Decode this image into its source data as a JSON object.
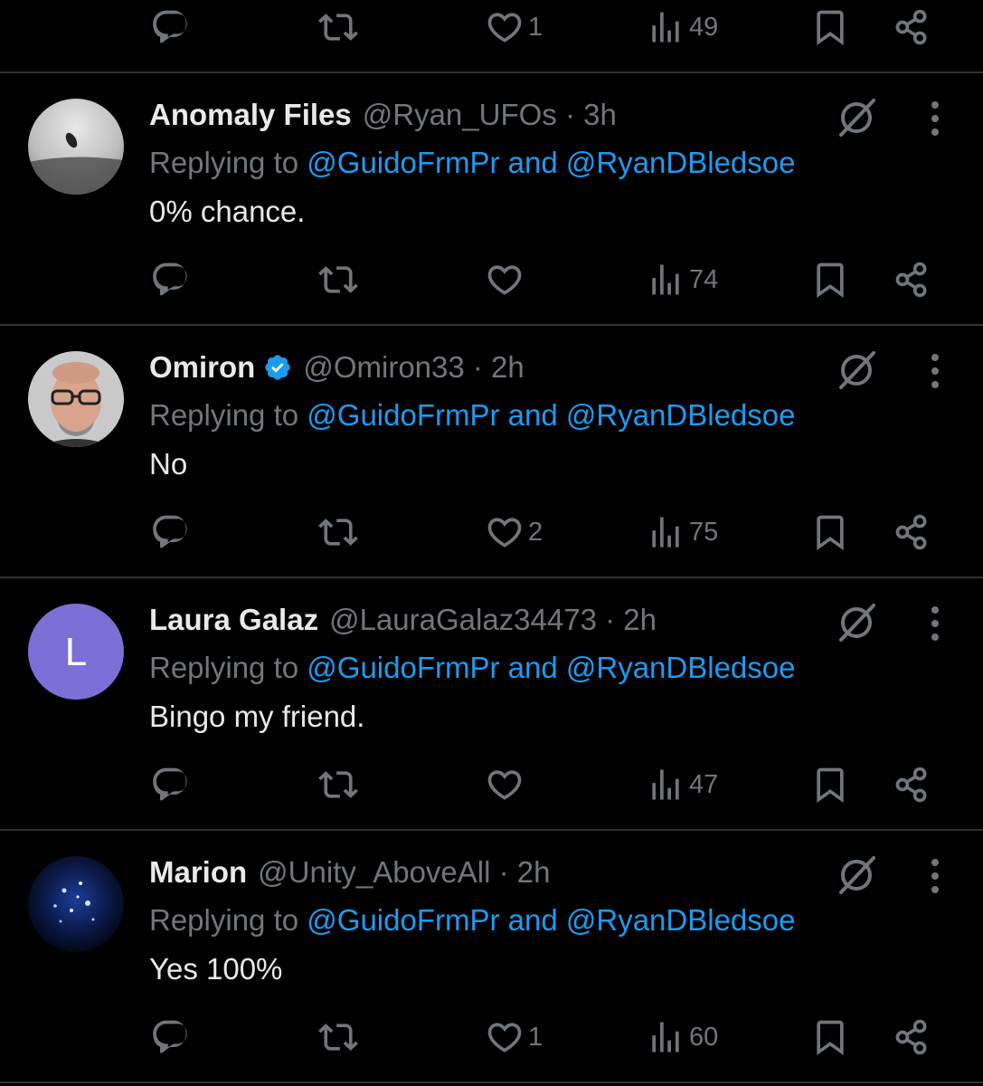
{
  "top_actions": {
    "likes": "1",
    "views": "49"
  },
  "replies": [
    {
      "name": "Anomaly Files",
      "handle": "@Ryan_UFOs · 3h",
      "verified": false,
      "replying_prefix": "Replying to",
      "replying_to": "@GuidoFrmPr and @RyanDBledsoe",
      "text": "0% chance.",
      "likes": "",
      "views": "74"
    },
    {
      "name": "Omiron",
      "handle": "@Omiron33 · 2h",
      "verified": true,
      "replying_prefix": "Replying to",
      "replying_to": "@GuidoFrmPr and @RyanDBledsoe",
      "text": "No",
      "likes": "2",
      "views": "75"
    },
    {
      "name": "Laura Galaz",
      "handle": "@LauraGalaz34473 · 2h",
      "verified": false,
      "avatar_letter": "L",
      "replying_prefix": "Replying to",
      "replying_to": "@GuidoFrmPr and @RyanDBledsoe",
      "text": "Bingo my friend.",
      "likes": "",
      "views": "47"
    },
    {
      "name": "Marion",
      "handle": "@Unity_AboveAll · 2h",
      "verified": false,
      "replying_prefix": "Replying to",
      "replying_to": "@GuidoFrmPr and @RyanDBledsoe",
      "text": "Yes 100%",
      "likes": "1",
      "views": "60"
    }
  ],
  "colors": {
    "background": "#000000",
    "text": "#e7e9ea",
    "muted": "#71767b",
    "link": "#1d9bf0",
    "divider": "#2f3336",
    "avatar_purple": "#7c6fd6"
  }
}
